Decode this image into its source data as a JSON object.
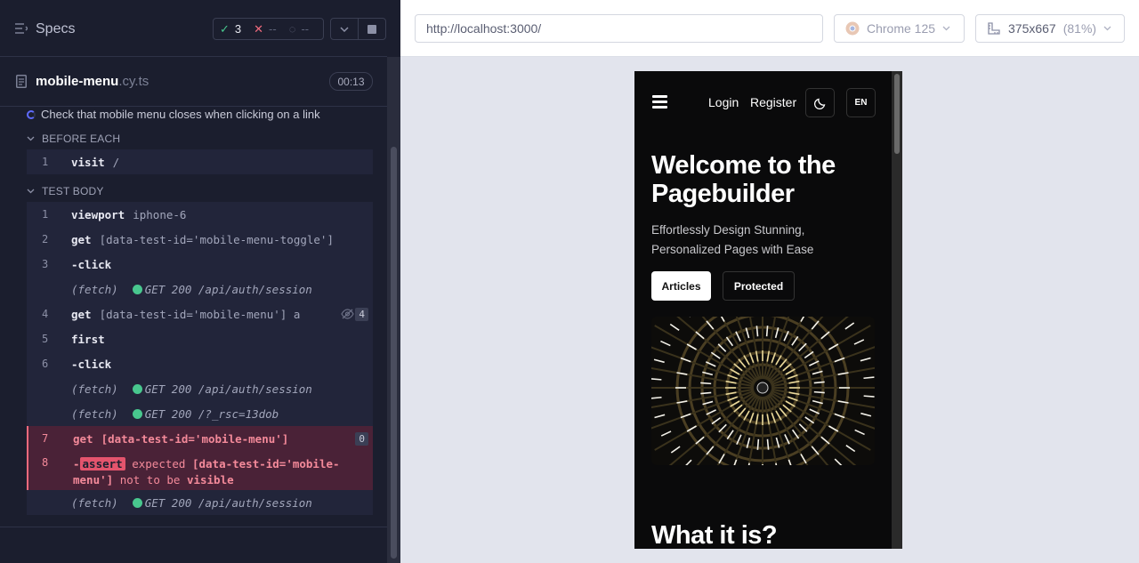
{
  "runner": {
    "title": "Specs",
    "stats": {
      "passed": "3",
      "failed": "--",
      "pending": "--"
    },
    "file": {
      "name": "mobile-menu",
      "ext": ".cy.ts",
      "duration": "00:13"
    },
    "test_title": "Check that mobile menu closes when clicking on a link",
    "before_each": {
      "label": "BEFORE EACH",
      "commands": [
        {
          "ln": "1",
          "cmd": "visit",
          "arg": "/"
        }
      ]
    },
    "test_body": {
      "label": "TEST BODY",
      "commands": [
        {
          "ln": "1",
          "cmd": "viewport",
          "arg": "iphone-6"
        },
        {
          "ln": "2",
          "cmd": "get",
          "arg": "[data-test-id='mobile-menu-toggle']"
        },
        {
          "ln": "3",
          "cmd": "-click",
          "arg": ""
        },
        {
          "fetch": "(fetch)",
          "req": "GET 200 /api/auth/session"
        },
        {
          "ln": "4",
          "cmd": "get",
          "arg": "[data-test-id='mobile-menu'] a",
          "badge": "4"
        },
        {
          "ln": "5",
          "cmd": "first",
          "arg": ""
        },
        {
          "ln": "6",
          "cmd": "-click",
          "arg": ""
        },
        {
          "fetch": "(fetch)",
          "req": "GET 200 /api/auth/session"
        },
        {
          "fetch": "(fetch)",
          "req": "GET 200 /?_rsc=13dob"
        },
        {
          "ln": "7",
          "cmd": "get",
          "arg": "[data-test-id='mobile-menu']",
          "badge": "0",
          "failed": true
        },
        {
          "ln": "8",
          "cmd": "-",
          "assert": "assert",
          "expected": "expected",
          "target": "[data-test-id='mobile-",
          "target2": "menu']",
          "not": "not to be",
          "vis": "visible",
          "failed": true
        },
        {
          "fetch": "(fetch)",
          "req": "GET 200 /api/auth/session"
        }
      ]
    }
  },
  "browser": {
    "url": "http://localhost:3000/",
    "name": "Chrome 125",
    "viewport": "375x667",
    "scale": "(81%)"
  },
  "app": {
    "nav": {
      "login": "Login",
      "register": "Register",
      "lang": "EN"
    },
    "hero": {
      "title": "Welcome to the Pagebuilder",
      "subtitle": "Effortlessly Design Stunning, Personalized Pages with Ease",
      "btn_primary": "Articles",
      "btn_secondary": "Protected"
    },
    "section_title": "What it is?"
  },
  "colors": {
    "pass": "#48c78e",
    "fail": "#f06a7d",
    "accent": "#5f6bff"
  }
}
